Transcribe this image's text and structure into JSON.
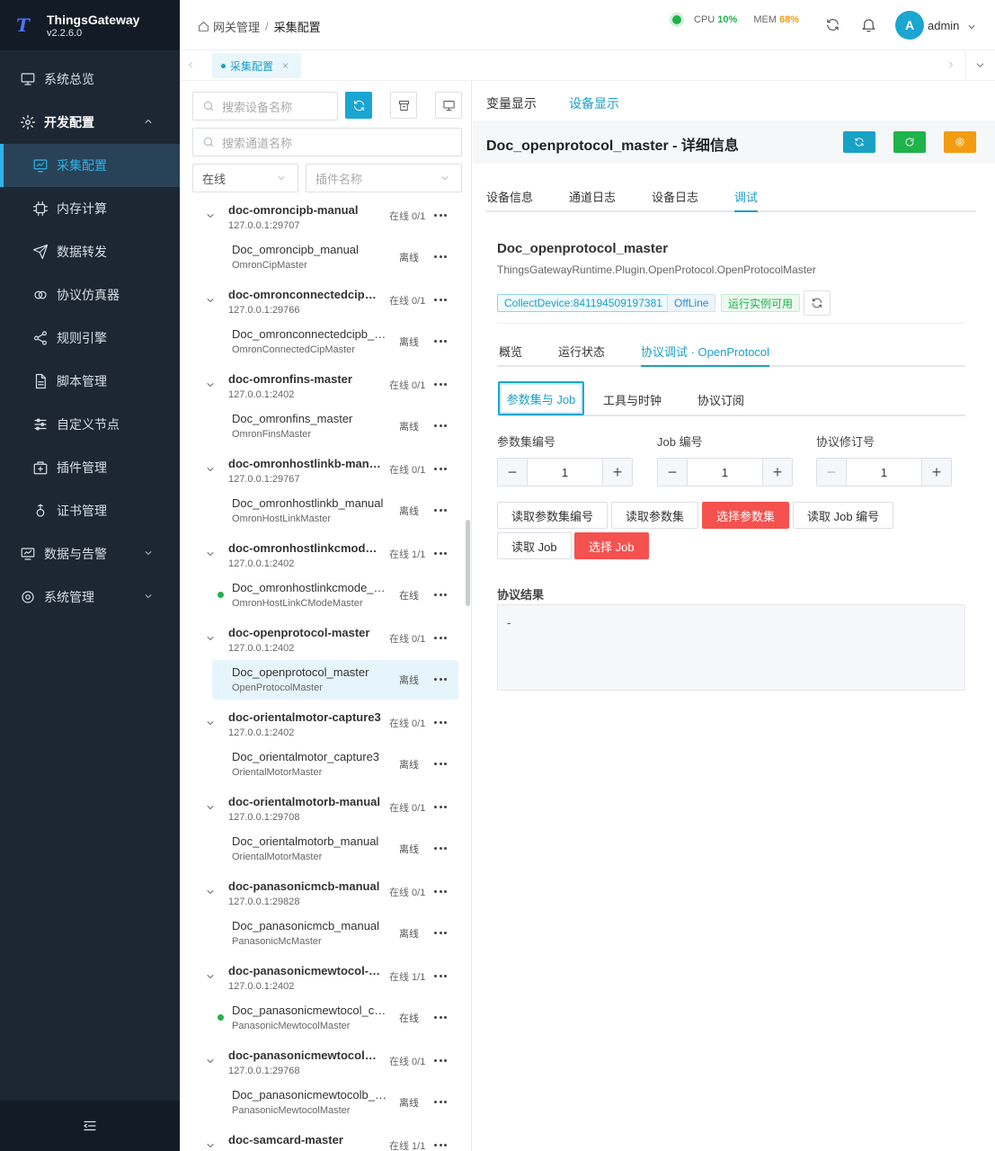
{
  "app": {
    "name": "ThingsGateway",
    "version": "v2.2.6.0",
    "logo_letter": "T"
  },
  "sidebar": {
    "items": [
      {
        "label": "系统总览"
      },
      {
        "label": "开发配置"
      },
      {
        "label": "采集配置"
      },
      {
        "label": "内存计算"
      },
      {
        "label": "数据转发"
      },
      {
        "label": "协议仿真器"
      },
      {
        "label": "规则引擎"
      },
      {
        "label": "脚本管理"
      },
      {
        "label": "自定义节点"
      },
      {
        "label": "插件管理"
      },
      {
        "label": "证书管理"
      },
      {
        "label": "数据与告警"
      },
      {
        "label": "系统管理"
      }
    ]
  },
  "header": {
    "breadcrumb": [
      "网关管理",
      "采集配置"
    ],
    "cpu_label": "CPU",
    "cpu_value": "10%",
    "mem_label": "MEM",
    "mem_value": "68%",
    "avatar_letter": "A",
    "user": "admin"
  },
  "tabs": {
    "active": "采集配置",
    "close": "×"
  },
  "device_panel": {
    "search_device_placeholder": "搜索设备名称",
    "search_channel_placeholder": "搜索通道名称",
    "status_filter": "在线",
    "plugin_filter_placeholder": "插件名称"
  },
  "tree": [
    {
      "channel": "doc-omroncipb-manual",
      "address": "127.0.0.1:29707",
      "count": "在线 0/1",
      "device": "Doc_omroncipb_manual",
      "plugin": "OmronCipMaster",
      "status": "离线",
      "online": false
    },
    {
      "channel": "doc-omronconnectedcipb-...",
      "address": "127.0.0.1:29766",
      "count": "在线 0/1",
      "device": "Doc_omronconnectedcipb_m...",
      "plugin": "OmronConnectedCipMaster",
      "status": "离线",
      "online": false
    },
    {
      "channel": "doc-omronfins-master",
      "address": "127.0.0.1:2402",
      "count": "在线 0/1",
      "device": "Doc_omronfins_master",
      "plugin": "OmronFinsMaster",
      "status": "离线",
      "online": false
    },
    {
      "channel": "doc-omronhostlinkb-manual",
      "address": "127.0.0.1:29767",
      "count": "在线 0/1",
      "device": "Doc_omronhostlinkb_manual",
      "plugin": "OmronHostLinkMaster",
      "status": "离线",
      "online": false
    },
    {
      "channel": "doc-omronhostlinkcmode-...",
      "address": "127.0.0.1:2402",
      "count": "在线 1/1",
      "device": "Doc_omronhostlinkcmode_m...",
      "plugin": "OmronHostLinkCModeMaster",
      "status": "在线",
      "online": true
    },
    {
      "channel": "doc-openprotocol-master",
      "address": "127.0.0.1:2402",
      "count": "在线 0/1",
      "device": "Doc_openprotocol_master",
      "plugin": "OpenProtocolMaster",
      "status": "离线",
      "online": false,
      "selected": true
    },
    {
      "channel": "doc-orientalmotor-capture3",
      "address": "127.0.0.1:2402",
      "count": "在线 0/1",
      "device": "Doc_orientalmotor_capture3",
      "plugin": "OrientalMotorMaster",
      "status": "离线",
      "online": false
    },
    {
      "channel": "doc-orientalmotorb-manual",
      "address": "127.0.0.1:29708",
      "count": "在线 0/1",
      "device": "Doc_orientalmotorb_manual",
      "plugin": "OrientalMotorMaster",
      "status": "离线",
      "online": false
    },
    {
      "channel": "doc-panasonicmcb-manual",
      "address": "127.0.0.1:29828",
      "count": "在线 0/1",
      "device": "Doc_panasonicmcb_manual",
      "plugin": "PanasonicMcMaster",
      "status": "离线",
      "online": false
    },
    {
      "channel": "doc-panasonicmewtocol-c...",
      "address": "127.0.0.1:2402",
      "count": "在线 1/1",
      "device": "Doc_panasonicmewtocol_cap...",
      "plugin": "PanasonicMewtocolMaster",
      "status": "在线",
      "online": true
    },
    {
      "channel": "doc-panasonicmewtocolb-...",
      "address": "127.0.0.1:29768",
      "count": "在线 0/1",
      "device": "Doc_panasonicmewtocolb_m...",
      "plugin": "PanasonicMewtocolMaster",
      "status": "离线",
      "online": false
    },
    {
      "channel": "doc-samcard-master",
      "address": "",
      "count": "在线 1/1"
    }
  ],
  "right": {
    "top_tabs": [
      "变量显示",
      "设备显示"
    ],
    "detail_title": "Doc_openprotocol_master - 详细信息",
    "inner_tabs": [
      "设备信息",
      "通道日志",
      "设备日志",
      "调试"
    ],
    "device_name": "Doc_openprotocol_master",
    "device_class": "ThingsGatewayRuntime.Plugin.OpenProtocol.OpenProtocolMaster",
    "badges": {
      "id": "CollectDevice:841194509197381",
      "state": "OffLine",
      "runtime": "运行实例可用"
    },
    "protocol_tabs": [
      "概览",
      "运行状态",
      "协议调试 · OpenProtocol"
    ],
    "sub_tabs": [
      "参数集与 Job",
      "工具与时钟",
      "协议订阅"
    ],
    "fields": [
      {
        "label": "参数集编号",
        "value": "1"
      },
      {
        "label": "Job 编号",
        "value": "1"
      },
      {
        "label": "协议修订号",
        "value": "1"
      }
    ],
    "actions": [
      "读取参数集编号",
      "读取参数集",
      "选择参数集",
      "读取 Job 编号",
      "读取 Job",
      "选择 Job"
    ],
    "result_label": "协议结果",
    "result_value": "-"
  },
  "colors": {
    "accent": "#1ba5d1",
    "success": "#20b24a",
    "warning": "#f39c12",
    "danger": "#f5524f",
    "sidebar_bg": "#1c2733"
  }
}
